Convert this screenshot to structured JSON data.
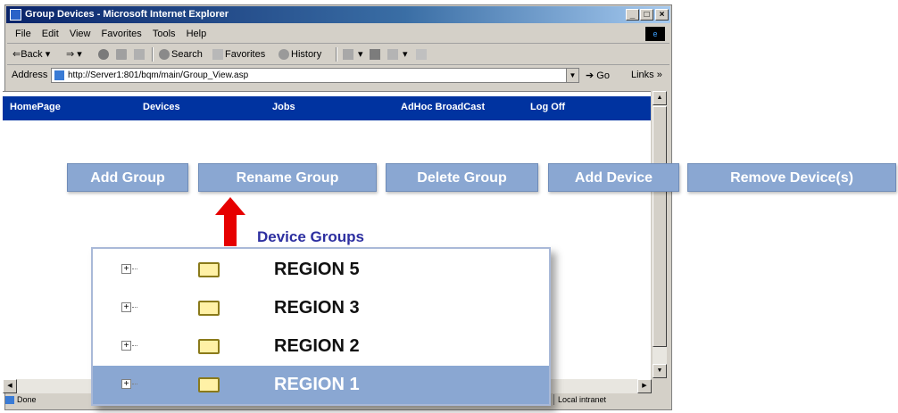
{
  "window": {
    "title": "Group Devices - Microsoft Internet Explorer",
    "controls": {
      "minimize": "_",
      "maximize": "□",
      "close": "×"
    }
  },
  "menubar": {
    "items": [
      "File",
      "Edit",
      "View",
      "Favorites",
      "Tools",
      "Help"
    ]
  },
  "toolbar": {
    "back": "Back",
    "forward": "⇒",
    "search": "Search",
    "favorites": "Favorites",
    "history": "History"
  },
  "address": {
    "label": "Address",
    "url": "http://Server1:801/bqm/main/Group_View.asp",
    "go": "Go",
    "links": "Links »"
  },
  "nav": {
    "items": [
      "HomePage",
      "Devices",
      "Jobs",
      "AdHoc BroadCast",
      "Log Off"
    ]
  },
  "actions": [
    "Add Group",
    "Rename Group",
    "Delete Group",
    "Add Device",
    "Remove Device(s)"
  ],
  "groups": {
    "title": "Device Groups",
    "items": [
      "REGION 5",
      "REGION 3",
      "REGION 2",
      "REGION 1"
    ],
    "selected": "REGION 1"
  },
  "status": {
    "left": "Done",
    "zone": "Local intranet"
  },
  "colors": {
    "nav_bg": "#0033a0",
    "button_bg": "#8aa7d2",
    "arrow": "#e60000",
    "groups_title": "#2d2fa0"
  }
}
